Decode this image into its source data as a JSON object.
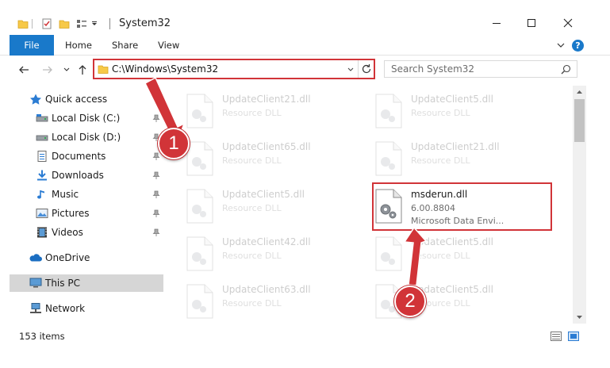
{
  "window": {
    "title": "System32",
    "controls": {
      "minimize": "—",
      "maximize": "☐",
      "close": "✕"
    }
  },
  "ribbon": {
    "tabs": [
      {
        "label": "File"
      },
      {
        "label": "Home"
      },
      {
        "label": "Share"
      },
      {
        "label": "View"
      }
    ],
    "expand_glyph": "⌄",
    "help_glyph": "?"
  },
  "nav": {
    "back": "←",
    "forward": "→",
    "recent": "⌄",
    "up": "↑",
    "address": "C:\\Windows\\System32",
    "refresh": "↻",
    "dropdown": "⌄",
    "search_placeholder": "Search System32"
  },
  "navpane": {
    "items": [
      {
        "label": "Quick access",
        "icon": "star-icon",
        "pinned": false
      },
      {
        "label": "Local Disk (C:)",
        "icon": "drive-icon",
        "pinned": true
      },
      {
        "label": "Local Disk (D:)",
        "icon": "drive-icon",
        "pinned": true
      },
      {
        "label": "Documents",
        "icon": "documents-icon",
        "pinned": true
      },
      {
        "label": "Downloads",
        "icon": "downloads-icon",
        "pinned": true
      },
      {
        "label": "Music",
        "icon": "music-icon",
        "pinned": true
      },
      {
        "label": "Pictures",
        "icon": "pictures-icon",
        "pinned": true
      },
      {
        "label": "Videos",
        "icon": "videos-icon",
        "pinned": true
      },
      {
        "label": "OneDrive",
        "icon": "onedrive-icon",
        "pinned": false
      },
      {
        "label": "This PC",
        "icon": "this-pc-icon",
        "pinned": false,
        "selected": true
      },
      {
        "label": "Network",
        "icon": "network-icon",
        "pinned": false
      }
    ]
  },
  "files": [
    {
      "name": "UpdateClient21.dll",
      "type": "Resource DLL",
      "faded": true
    },
    {
      "name": "UpdateClient5.dll",
      "type": "Resource DLL",
      "faded": true
    },
    {
      "name": "UpdateClient65.dll",
      "type": "Resource DLL",
      "faded": true
    },
    {
      "name": "UpdateClient21.dll",
      "type": "Resource DLL",
      "faded": true
    },
    {
      "name": "UpdateClient5.dll",
      "type": "Resource DLL",
      "faded": true
    },
    {
      "name": "msderun.dll",
      "type": "6.00.8804",
      "company": "Microsoft Data Envi...",
      "faded": false
    },
    {
      "name": "UpdateClient42.dll",
      "type": "Resource DLL",
      "faded": true
    },
    {
      "name": "UpdateClient5.dll",
      "type": "Resource DLL",
      "faded": true
    },
    {
      "name": "UpdateClient63.dll",
      "type": "Resource DLL",
      "faded": true
    },
    {
      "name": "UpdateClient5.dll",
      "type": "Resource DLL",
      "faded": true
    }
  ],
  "status": {
    "item_count": "153 items"
  },
  "callouts": [
    {
      "number": "1"
    },
    {
      "number": "2"
    }
  ],
  "colors": {
    "accent": "#1979ca",
    "callout": "#d13438",
    "selected": "#d6d6d6"
  }
}
